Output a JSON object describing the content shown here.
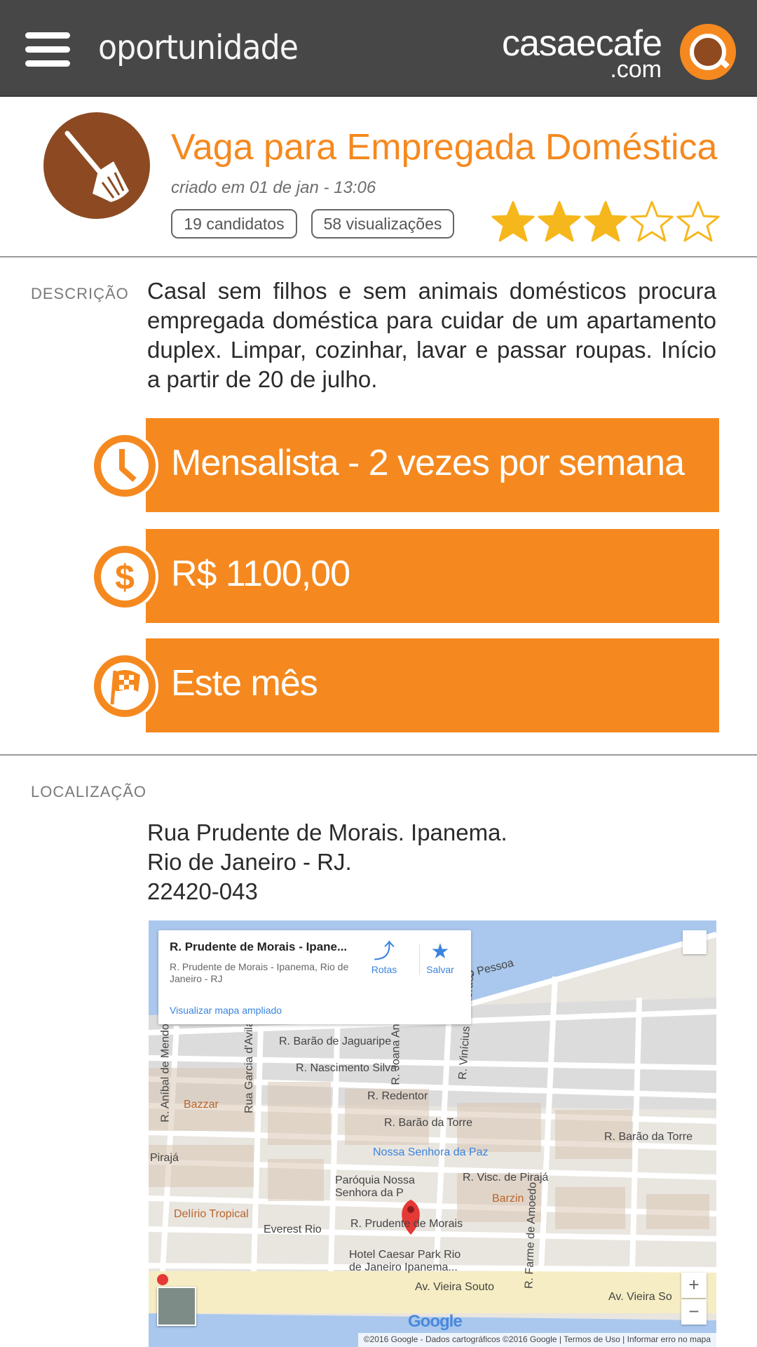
{
  "header": {
    "page_title": "oportunidade",
    "logo_main": "casaecafe",
    "logo_sub": ".com"
  },
  "job": {
    "title": "Vaga para Empregada Doméstica",
    "created": "criado em 01 de jan - 13:06",
    "candidates": "19 candidatos",
    "views": "58 visualizações",
    "rating": 3,
    "rating_max": 5,
    "icon": "broom-icon"
  },
  "description": {
    "label": "DESCRIÇÃO",
    "text": "Casal sem filhos e sem animais domésticos procura empregada doméstica para cuidar de um apartamento duplex. Limpar, cozinhar, lavar e passar roupas. Início a partir de 20 de julho."
  },
  "details": [
    {
      "icon": "clock-icon",
      "text": "Mensalista - 2 vezes por semana"
    },
    {
      "icon": "dollar-icon",
      "text": "R$ 1100,00"
    },
    {
      "icon": "checkered-flag-icon",
      "text": "Este mês"
    }
  ],
  "location": {
    "label": "LOCALIZAÇÃO",
    "line1": "Rua Prudente de Morais. Ipanema.",
    "line2": "Rio de Janeiro - RJ.",
    "line3": "22420-043"
  },
  "map": {
    "card_title": "R. Prudente de Morais - Ipane...",
    "card_subtitle": "R. Prudente de Morais - Ipanema, Rio de Janeiro - RJ",
    "card_link": "Visualizar mapa ampliado",
    "directions_label": "Rotas",
    "save_label": "Salvar",
    "zoom_in": "+",
    "zoom_out": "−",
    "google": "Google",
    "footer": "©2016 Google - Dados cartográficos ©2016 Google  |  Termos de Uso  |  Informar erro no mapa",
    "labels": {
      "pessoa": "o Pessoa",
      "jaguaribe": "R. Barão de Jaguaripe",
      "nascimento": "R. Nascimento Silva",
      "redentor": "R. Redentor",
      "barao_torre": "R. Barão da Torre",
      "barao_torre_2": "R. Barão da Torre",
      "nossa_senhora": "Nossa Senhora da Paz",
      "paroquia": "Paróquia Nossa\nSenhora da P",
      "visc_piraja": "R. Visc. de Pirajá",
      "barzin": "Barzin",
      "delirio": "Delírio Tropical",
      "everest": "Everest Rio",
      "prudente": "R. Prudente de Morais",
      "caesar": "Hotel Caesar Park Rio\nde Janeiro Ipanema...",
      "vieira": "Av. Vieira Souto",
      "vieira_2": "Av. Vieira So",
      "bazzar": "Bazzar",
      "piraja": "Pirajá",
      "anibal": "R. Aníbal de Mendonç",
      "garcia": "Rua Garcia d'Avila",
      "joana": "R. Joana Anç",
      "vinicius": "R. Vinícius de Moraes",
      "farme": "R. Farme de Amoedo"
    }
  }
}
